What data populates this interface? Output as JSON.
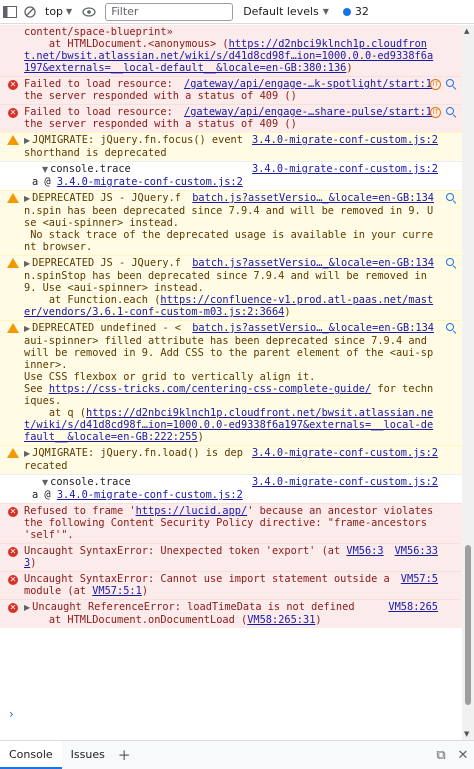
{
  "toolbar": {
    "context": "top",
    "filter_placeholder": "Filter",
    "levels": "Default levels",
    "issue_count": "32"
  },
  "messages": [
    {
      "type": "error-cont",
      "lines": [
        "content/space-blueprint»",
        "    at HTMLDocument.<anonymous> (",
        "https://d2nbci9klnch1p.cloudfront.net/bwsit.atlassian.net/wiki/s/d41d8cd98f…ion=1000.0.0-ed9338f6a197&externals=__local-default__&locale=en-GB:380:136",
        ")"
      ]
    },
    {
      "type": "error",
      "text": "Failed to load resource: the server responded with a status of 409 ()",
      "source": "/gateway/api/engage-…k-spotlight/start:1"
    },
    {
      "type": "error",
      "text": "Failed to load resource: the server responded with a status of 409 ()",
      "source": "/gateway/api/engage-…share-pulse/start:1"
    },
    {
      "type": "warn",
      "text": "JQMIGRATE: jQuery.fn.focus() event shorthand is deprecated",
      "source": "3.4.0-migrate-conf-custom.js:2"
    },
    {
      "type": "trace",
      "label": "console.trace",
      "source": "3.4.0-migrate-conf-custom.js:2",
      "frame_prefix": "a @ ",
      "frame_link": "3.4.0-migrate-conf-custom.js:2"
    },
    {
      "type": "warn",
      "text": "DEPRECATED JS - JQuery.fn.spin has been deprecated since 7.9.4 and will be removed in 9. Use <aui-spinner> instead.\n No stack trace of the deprecated usage is available in your current browser.",
      "source": "batch.js?assetVersio…_&locale=en-GB:134"
    },
    {
      "type": "warn",
      "text": "DEPRECATED JS - JQuery.fn.spinStop has been deprecated since 7.9.4 and will be removed in 9. Use <aui-spinner> instead.\n    at Function.each (",
      "link": "https://confluence-v1.prod.atl-paas.net/master/vendors/3.6.1-conf-custom-m03.js:2:3664",
      "tail": ")",
      "source": "batch.js?assetVersio…_&locale=en-GB:134"
    },
    {
      "type": "warn",
      "text": "DEPRECATED undefined - <aui-spinner> filled attribute has been deprecated since 7.9.4 and will be removed in 9. Add CSS to the parent element of the <aui-spinner>.\nUse CSS flexbox or grid to vertically align it.\nSee ",
      "link": "https://css-tricks.com/centering-css-complete-guide/",
      "mid": " for techniques.\n    at q (",
      "link2": "https://d2nbci9klnch1p.cloudfront.net/bwsit.atlassian.net/wiki/s/d41d8cd98f…ion=1000.0.0-ed9338f6a197&externals=__local-default__&locale=en-GB:222:255",
      "tail": ")",
      "source": "batch.js?assetVersio…_&locale=en-GB:134"
    },
    {
      "type": "warn",
      "text": "JQMIGRATE: jQuery.fn.load() is deprecated",
      "source": "3.4.0-migrate-conf-custom.js:2"
    },
    {
      "type": "trace",
      "label": "console.trace",
      "source": "3.4.0-migrate-conf-custom.js:2",
      "frame_prefix": "a @ ",
      "frame_link": "3.4.0-migrate-conf-custom.js:2"
    },
    {
      "type": "error",
      "text": "Refused to frame '",
      "link": "https://lucid.app/",
      "tail": "' because an ancestor violates the following Content Security Policy directive: \"frame-ancestors 'self'\"."
    },
    {
      "type": "error",
      "text": "Uncaught SyntaxError: Unexpected token 'export' (at ",
      "link": "VM56:33",
      "tail": ")",
      "source": "VM56:33"
    },
    {
      "type": "error",
      "text": "Uncaught SyntaxError: Cannot use import statement outside a module (at ",
      "link": "VM57:5:1",
      "tail": ")",
      "source": "VM57:5"
    },
    {
      "type": "error",
      "text": "Uncaught ReferenceError: loadTimeData is not defined\n    at HTMLDocument.onDocumentLoad (",
      "link": "VM58:265:31",
      "tail": ")",
      "source": "VM58:265"
    }
  ],
  "drawer": {
    "tab_console": "Console",
    "tab_issues": "Issues"
  },
  "colors": {
    "error_bg": "#fcebeb",
    "warn_bg": "#fffbe5",
    "link": "#1a1aa6",
    "accent": "#1a73e8"
  }
}
